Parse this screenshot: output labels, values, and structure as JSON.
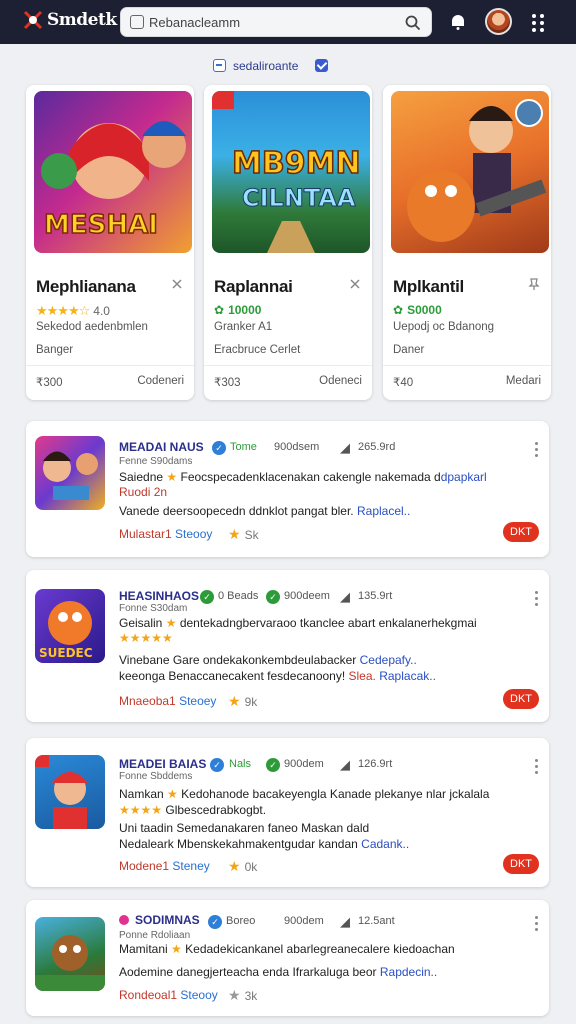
{
  "app": {
    "logo_text": "Smdetk"
  },
  "search": {
    "placeholder": "Rebanacleamm"
  },
  "filter": {
    "label": "sedaliroante"
  },
  "cards": [
    {
      "title": "Mephlianana",
      "rating": "4.0",
      "subtitle": "Sekedod aedenbmlen",
      "meta": "Banger",
      "foot_left": "₹300",
      "foot_right": "Codeneri"
    },
    {
      "title": "Raplannai",
      "rating": "10000",
      "subtitle": "Granker A1",
      "meta": "Eracbruce Cerlet",
      "foot_left": "₹303",
      "foot_right": "Odeneci"
    },
    {
      "title": "Mplkantil",
      "rating": "S0000",
      "subtitle": "Uepodj oc Bdanong",
      "meta": "Daner",
      "foot_left": "₹40",
      "foot_right": "Medari"
    }
  ],
  "items": [
    {
      "title": "MEADAI NAUS",
      "tag": "Tome",
      "count": "900dsem",
      "size": "265.9rd",
      "sub": "Fenne S90dams",
      "line1": "Saiedne",
      "line1b": "Feocspecadenklacenakan cakengle nakemada d",
      "line1link": "dpapkarl",
      "line2": "Ruodi 2n",
      "line3": "Vanede deersoopecedn ddnklot pangat bler.",
      "line3link": "Raplacel..",
      "foot_a": "Mulastar1",
      "foot_b": "Steooy",
      "likes": "Sk",
      "button": "DKT"
    },
    {
      "title": "HEASINHAOS",
      "tag": "0 Beads",
      "count": "900deem",
      "size": "135.9rt",
      "sub": "Fonne S30dam",
      "line1": "Geisalin",
      "line1b": "dentekadngbervaraoo tkanclee abart enkalanerhekgmai",
      "line1link": "",
      "line2": "",
      "line3": "Vinebane Gare ondekakonkembdeulabacker",
      "line3link": "Cedepafy..",
      "line4": "keeonga Benaccanecakent fesdecanoony!",
      "line4red": "Slea.",
      "line4link": "Raplacak..",
      "foot_a": "Mnaeoba1",
      "foot_b": "Steoey",
      "likes": "9k",
      "button": "DKT"
    },
    {
      "title": "MEADEI BAIAS",
      "tag": "Nals",
      "count": "900dem",
      "size": "126.9rt",
      "sub": "Fonne Sbddems",
      "line1": "Namkan",
      "line1b": "Kedohanode bacakeyengla Kanade plekanye nlar jckalala",
      "line1link": "",
      "line2": "Glbescedrabkogbt.",
      "line3": "Uni taadin Semedanakaren faneo Maskan dald",
      "line3link": "",
      "line4": "Nedaleark Mbenskekahmakentgudar kandan",
      "line4red": "",
      "line4link": "Cadank..",
      "foot_a": "Modene1",
      "foot_b": "Steney",
      "likes": "0k",
      "button": "DKT"
    },
    {
      "title": "SODIMNAS",
      "tag": "Boreo",
      "count": "900dem",
      "size": "12.5ant",
      "sub": "Ponne Rdoliaan",
      "line1": "Mamitani",
      "line1b": "Kedadekicankanel abarlegreanecalere kiedoachan",
      "line1link": "",
      "line2": "",
      "line3": "Aodemine danegjerteacha enda Ifrarkaluga beor",
      "line3link": "Rapdecin..",
      "foot_a": "Rondeoal1",
      "foot_b": "Steooy",
      "likes": "3k",
      "button": ""
    }
  ],
  "colors": {
    "topbar": "#1d1f33",
    "accent_red": "#e0321e",
    "link_blue": "#2a4fc2",
    "star": "#f3b417"
  }
}
